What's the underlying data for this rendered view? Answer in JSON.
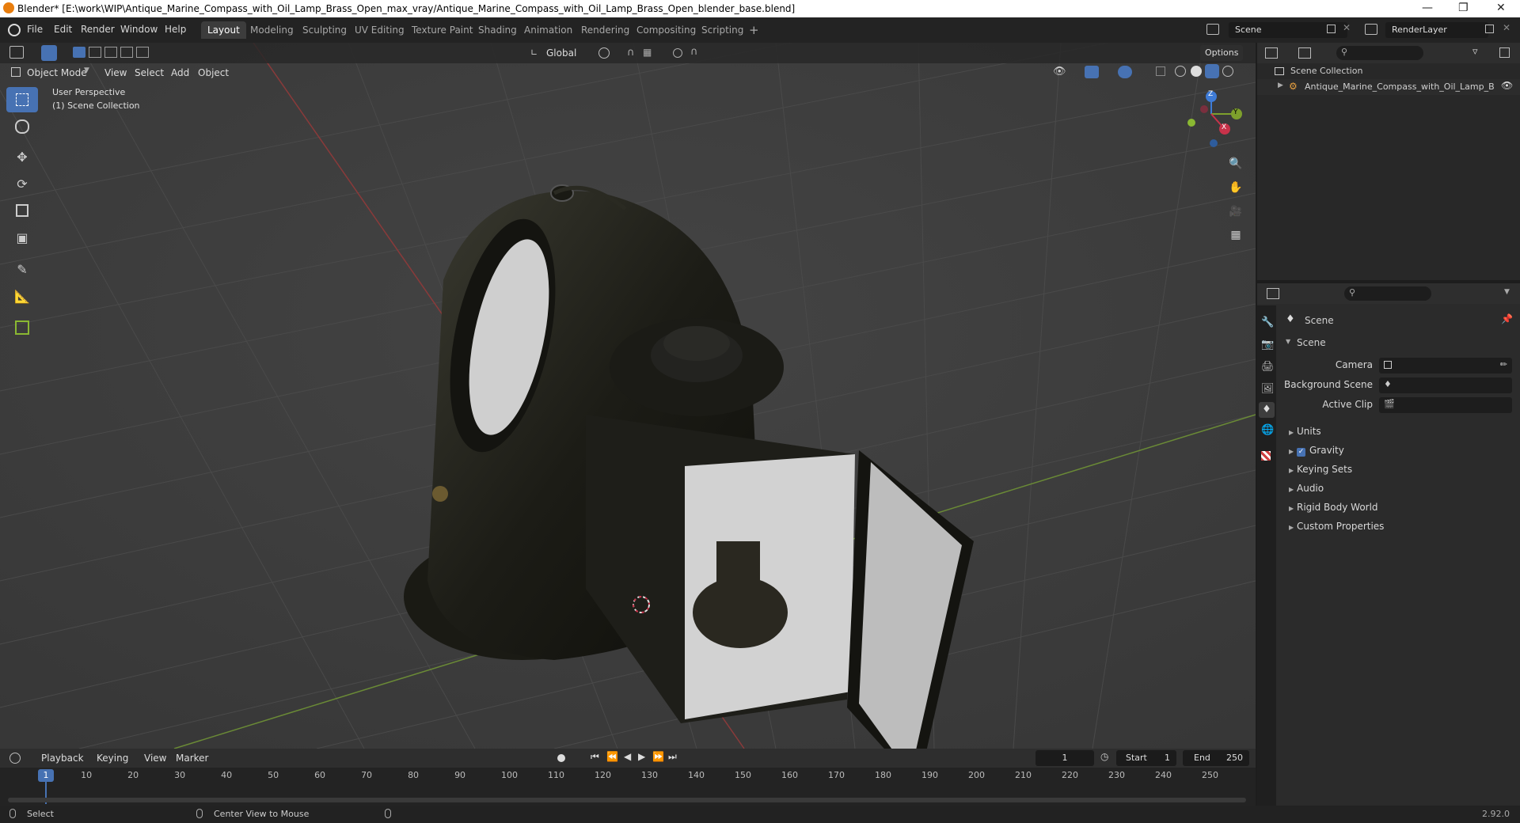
{
  "window": {
    "title": "Blender* [E:\\work\\WIP\\Antique_Marine_Compass_with_Oil_Lamp_Brass_Open_max_vray/Antique_Marine_Compass_with_Oil_Lamp_Brass_Open_blender_base.blend]"
  },
  "menu": {
    "file": "File",
    "edit": "Edit",
    "render": "Render",
    "window": "Window",
    "help": "Help"
  },
  "workspaces": [
    "Layout",
    "Modeling",
    "Sculpting",
    "UV Editing",
    "Texture Paint",
    "Shading",
    "Animation",
    "Rendering",
    "Compositing",
    "Scripting"
  ],
  "scene_field": "Scene",
  "renderlayer_field": "RenderLayer",
  "viewport": {
    "transform_orientation": "Global",
    "options_label": "Options",
    "mode": "Object Mode",
    "view_menu": "View",
    "select_menu": "Select",
    "add_menu": "Add",
    "object_menu": "Object",
    "perspective_label": "User Perspective",
    "collection_label": "(1) Scene Collection",
    "gizmo": {
      "z": "Z",
      "y": "Y",
      "x": "X"
    }
  },
  "outliner": {
    "root": "Scene Collection",
    "item": "Antique_Marine_Compass_with_Oil_Lamp_B"
  },
  "properties": {
    "header": "Scene",
    "section": "Scene",
    "camera_label": "Camera",
    "background_scene_label": "Background Scene",
    "active_clip_label": "Active Clip",
    "panels": [
      "Units",
      "Gravity",
      "Keying Sets",
      "Audio",
      "Rigid Body World",
      "Custom Properties"
    ],
    "gravity_checked": true
  },
  "timeline": {
    "playback": "Playback",
    "keying": "Keying",
    "view": "View",
    "marker": "Marker",
    "current_frame": "1",
    "start_label": "Start",
    "start_value": "1",
    "end_label": "End",
    "end_value": "250",
    "ticks": [
      "1",
      "10",
      "20",
      "30",
      "40",
      "50",
      "60",
      "70",
      "80",
      "90",
      "100",
      "110",
      "120",
      "130",
      "140",
      "150",
      "160",
      "170",
      "180",
      "190",
      "200",
      "210",
      "220",
      "230",
      "240",
      "250"
    ]
  },
  "status": {
    "select": "Select",
    "center_view": "Center View to Mouse",
    "version": "2.92.0"
  },
  "colors": {
    "accent": "#4772b3",
    "x_axis": "#c8324a",
    "y_axis": "#7ea02c",
    "z_axis": "#3e7bd6"
  }
}
